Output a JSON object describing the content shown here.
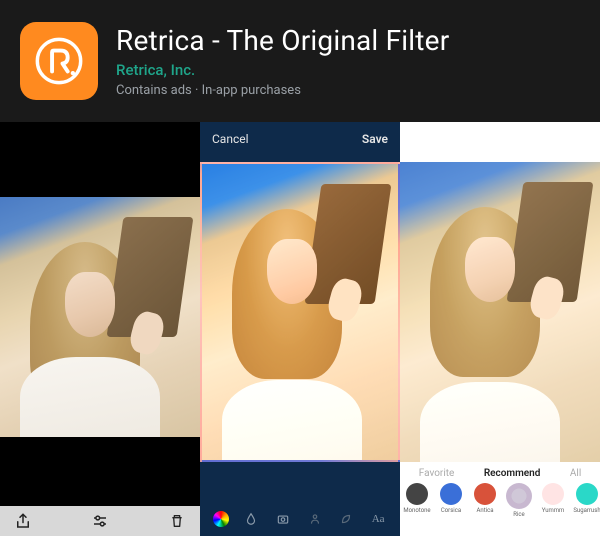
{
  "header": {
    "app_title": "Retrica - The Original Filter",
    "developer": "Retrica, Inc.",
    "ad_info": "Contains ads · In-app purchases",
    "icon_letter": "R"
  },
  "screen2": {
    "cancel": "Cancel",
    "save": "Save"
  },
  "screen3": {
    "favorite_tab": "Favorite",
    "recommend_tab": "Recommend",
    "all_tab": "All",
    "filters": [
      {
        "name": "Monotone",
        "color": "#444"
      },
      {
        "name": "Corsica",
        "color": "#3a6fd8"
      },
      {
        "name": "Antica",
        "color": "#d8523a"
      },
      {
        "name": "Rice",
        "color": "#c8b8d0"
      },
      {
        "name": "Yummm",
        "color": "#ffe4e4"
      },
      {
        "name": "Sugarrush",
        "color": "#2ad8c8"
      }
    ],
    "selected_filter": "Rice"
  },
  "bottombar2_icons": [
    "colorwheel-icon",
    "drop-icon",
    "camera-icon",
    "person-icon",
    "leaf-icon",
    "text-icon"
  ],
  "bottombar1_icons": [
    "share-icon",
    "sliders-icon",
    "trash-icon"
  ]
}
